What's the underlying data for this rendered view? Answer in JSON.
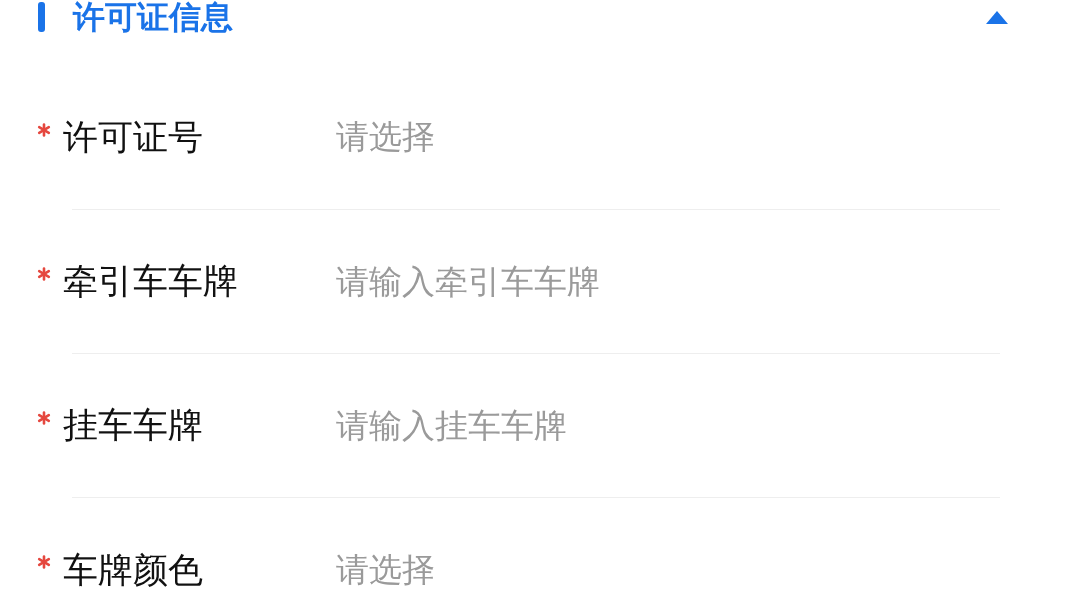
{
  "section": {
    "title": "许可证信息",
    "expanded": true
  },
  "fields": [
    {
      "label": "许可证号",
      "required": true,
      "kind": "select",
      "placeholder": "请选择"
    },
    {
      "label": "牵引车车牌",
      "required": true,
      "kind": "input",
      "placeholder": "请输入牵引车车牌"
    },
    {
      "label": "挂车车牌",
      "required": true,
      "kind": "input",
      "placeholder": "请输入挂车车牌"
    },
    {
      "label": "车牌颜色",
      "required": true,
      "kind": "select",
      "placeholder": "请选择"
    }
  ]
}
